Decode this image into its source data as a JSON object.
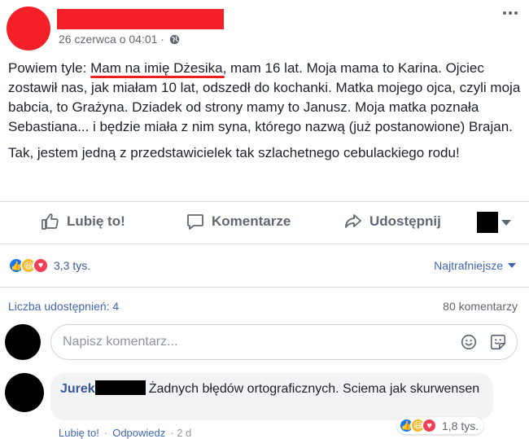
{
  "post": {
    "time": "26 czerwca o 04:01 ·",
    "text_prefix": "Powiem tyle: ",
    "text_highlight": "Mam na imię Dżesika",
    "text_rest": ", mam 16 lat. Moja mama to Karina. Ojciec zostawił nas, jak miałam 10 lat, odszedł do kochanki. Matka mojego ojca, czyli moja babcia, to Grażyna. Dziadek od strony mamy to Janusz. Moja matka poznała Sebastiana... i będzie miała z nim syna, którego nazwą (już postanowione) Brajan.",
    "text_2": "Tak, jestem jedną z przedstawicielek tak szlachetnego cebulackiego rodu!"
  },
  "actions": {
    "like": "Lubię to!",
    "comment": "Komentarze",
    "share": "Udostępnij"
  },
  "reactions": {
    "count": "3,3 tys.",
    "sort": "Najtrafniejsze"
  },
  "stats": {
    "shares": "Liczba udostępnień: 4",
    "comments": "80 komentarzy"
  },
  "comment_input": {
    "placeholder": "Napisz komentarz..."
  },
  "comment": {
    "author": "Jurek",
    "text": "Żadnych błędów ortograficznych. Sciema jak skurwensen",
    "reactions_count": "1,8 tys.",
    "like": "Lubię to!",
    "reply": "Odpowiedz",
    "age": "· 2 d"
  },
  "colors": {
    "redaction_red": "#f32027",
    "link_blue": "#4267b2",
    "underline_red": "#e8201e"
  }
}
